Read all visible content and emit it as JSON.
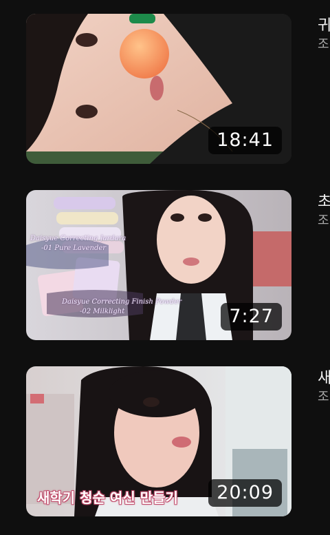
{
  "videos": [
    {
      "title": "귀",
      "channel": "조",
      "duration": "18:41",
      "caption": "",
      "labels": []
    },
    {
      "title": "초",
      "channel": "조",
      "duration": "7:27",
      "caption": "",
      "labels": [
        "Daisyue Correcting Jardara",
        "-01 Pure Lavender",
        "Daisyue Correcting Finish Powder",
        "-02 Milklight"
      ]
    },
    {
      "title": "새",
      "channel": "조",
      "duration": "20:09",
      "caption": "새학기 청순 여신 만들기",
      "labels": []
    }
  ]
}
